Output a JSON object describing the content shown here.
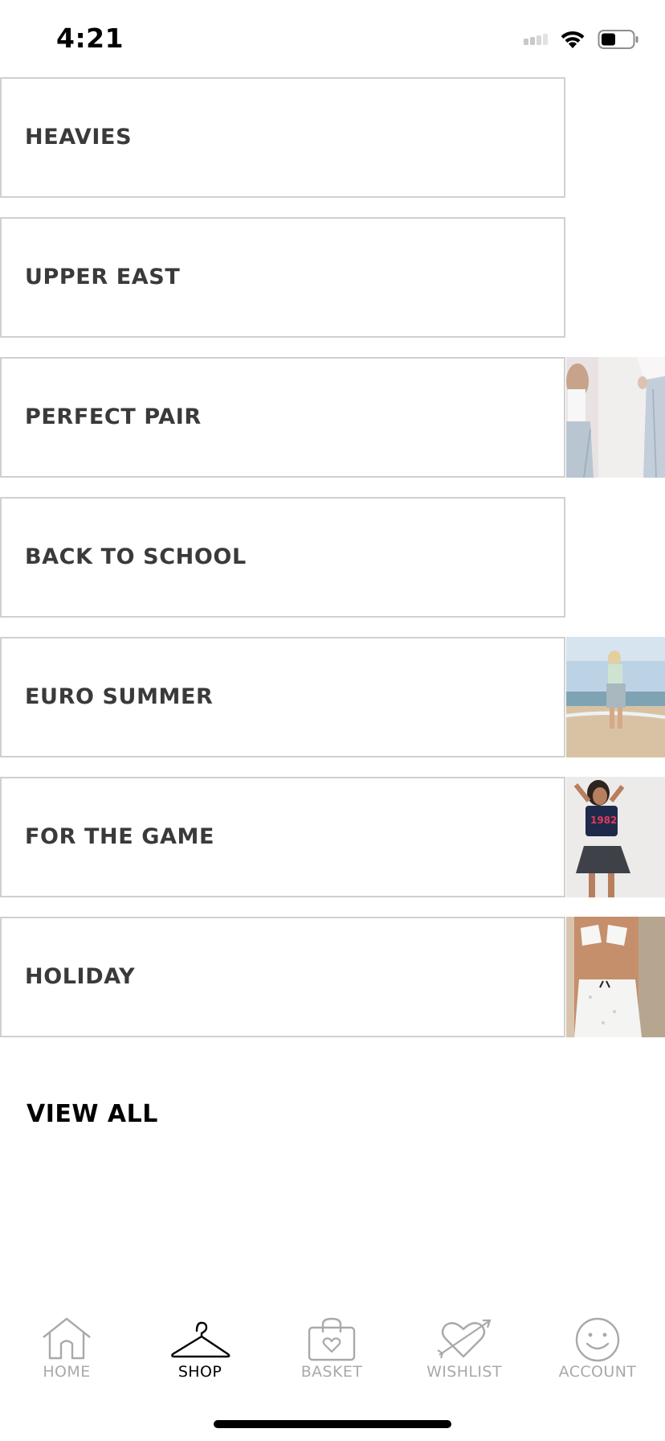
{
  "status_bar": {
    "time": "4:21"
  },
  "categories": [
    {
      "label": "HEAVIES",
      "has_image": false
    },
    {
      "label": "UPPER EAST",
      "has_image": false
    },
    {
      "label": "PERFECT PAIR",
      "has_image": true
    },
    {
      "label": "BACK TO SCHOOL",
      "has_image": false
    },
    {
      "label": "EURO SUMMER",
      "has_image": true
    },
    {
      "label": "FOR THE GAME",
      "has_image": true
    },
    {
      "label": "HOLIDAY",
      "has_image": true
    }
  ],
  "view_all": "VIEW ALL",
  "tab_bar": {
    "items": [
      {
        "label": "HOME",
        "icon": "home-icon",
        "active": false
      },
      {
        "label": "SHOP",
        "icon": "hanger-icon",
        "active": true
      },
      {
        "label": "BASKET",
        "icon": "basket-icon",
        "active": false
      },
      {
        "label": "WISHLIST",
        "icon": "heart-arrow-icon",
        "active": false
      },
      {
        "label": "ACCOUNT",
        "icon": "smiley-icon",
        "active": false
      }
    ]
  },
  "colors": {
    "inactive_tab": "#a9a9a9",
    "active_tab": "#000000",
    "category_text": "#3a3a3a",
    "border": "#d0d0d0"
  }
}
